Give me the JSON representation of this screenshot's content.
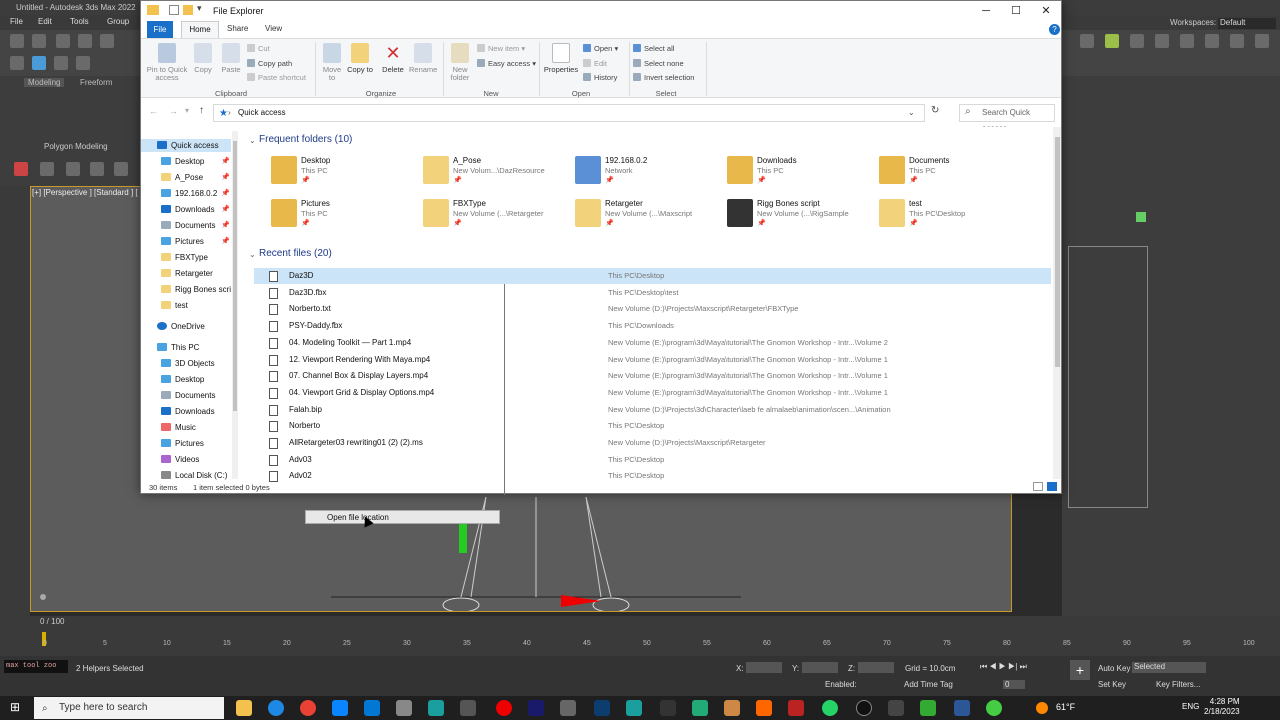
{
  "max": {
    "title": "Untitled - Autodesk 3ds Max 2022",
    "menu": [
      "File",
      "Edit",
      "Tools",
      "Group"
    ],
    "ribbon_tabs": [
      "Modeling",
      "Freeform"
    ],
    "ribbon_panel": "Polygon Modeling",
    "viewport_label": "[+] [Perspective ] [Standard ] [",
    "workspaces_label": "Workspaces:",
    "workspaces_value": "Default",
    "context_menu_item": "Open file location",
    "frame_counter": "0 / 100",
    "timeline_ticks": [
      "0",
      "5",
      "10",
      "15",
      "20",
      "25",
      "30",
      "35",
      "40",
      "45",
      "50",
      "55",
      "60",
      "65",
      "70",
      "75",
      "80",
      "85",
      "90",
      "95",
      "100"
    ],
    "maxscript_text": "max tool zoo",
    "selection_status": "2 Helpers Selected",
    "x_label": "X:",
    "y_label": "Y:",
    "z_label": "Z:",
    "grid_text": "Grid = 10.0cm",
    "enabled_label": "Enabled:",
    "add_time_tag": "Add Time Tag",
    "auto_key": "Auto Key",
    "set_key": "Set Key",
    "selected_dropdown": "Selected",
    "key_filters": "Key Filters...",
    "frame_field": "0"
  },
  "explorer": {
    "title": "File Explorer",
    "tabs": {
      "file": "File",
      "home": "Home",
      "share": "Share",
      "view": "View"
    },
    "ribbon": {
      "pin": "Pin to Quick access",
      "copy": "Copy",
      "paste": "Paste",
      "cut": "Cut",
      "copy_path": "Copy path",
      "paste_shortcut": "Paste shortcut",
      "group_clipboard": "Clipboard",
      "move_to": "Move to",
      "copy_to": "Copy to",
      "delete": "Delete",
      "rename": "Rename",
      "group_organize": "Organize",
      "new_folder": "New folder",
      "new_item": "New item",
      "easy_access": "Easy access",
      "group_new": "New",
      "properties": "Properties",
      "open": "Open",
      "edit": "Edit",
      "history": "History",
      "group_open": "Open",
      "select_all": "Select all",
      "select_none": "Select none",
      "invert_selection": "Invert selection",
      "group_select": "Select"
    },
    "address": "Quick access",
    "search_placeholder": "Search Quick access",
    "nav": {
      "quick_access": "Quick access",
      "pinned": [
        "Desktop",
        "A_Pose",
        "192.168.0.2",
        "Downloads",
        "Documents",
        "Pictures"
      ],
      "unpinned": [
        "FBXType",
        "Retargeter",
        "Rigg Bones scri",
        "test"
      ],
      "onedrive": "OneDrive",
      "this_pc": "This PC",
      "pc_items": [
        "3D Objects",
        "Desktop",
        "Documents",
        "Downloads",
        "Music",
        "Pictures",
        "Videos",
        "Local Disk (C:)"
      ]
    },
    "frequent_header": "Frequent folders (10)",
    "frequent": [
      {
        "name": "Desktop",
        "loc": "This PC",
        "color": "#e8b84a"
      },
      {
        "name": "A_Pose",
        "loc": "New Volum...\\DazResource",
        "color": "#f2d27a"
      },
      {
        "name": "192.168.0.2",
        "loc": "Network",
        "color": "#5b8fd6"
      },
      {
        "name": "Downloads",
        "loc": "This PC",
        "color": "#e8b84a"
      },
      {
        "name": "Documents",
        "loc": "This PC",
        "color": "#e8b84a"
      },
      {
        "name": "Pictures",
        "loc": "This PC",
        "color": "#e8b84a"
      },
      {
        "name": "FBXType",
        "loc": "New Volume (...\\Retargeter",
        "color": "#f2d27a"
      },
      {
        "name": "Retargeter",
        "loc": "New Volume (...\\Maxscript",
        "color": "#f2d27a"
      },
      {
        "name": "Rigg Bones script",
        "loc": "New Volume (...\\RigSample",
        "color": "#333333"
      },
      {
        "name": "test",
        "loc": "This PC\\Desktop",
        "color": "#f2d27a"
      }
    ],
    "pin_glyph": "📌",
    "recent_header": "Recent files (20)",
    "recent": [
      {
        "name": "Daz3D",
        "path": "This PC\\Desktop"
      },
      {
        "name": "Daz3D.fbx",
        "path": "This PC\\Desktop\\test"
      },
      {
        "name": "Norberto.txt",
        "path": "New Volume (D:)\\Projects\\Maxscript\\Retargeter\\FBXType"
      },
      {
        "name": "PSY-Daddy.fbx",
        "path": "This PC\\Downloads"
      },
      {
        "name": "04. Modeling Toolkit — Part 1.mp4",
        "path": "New Volume (E:)\\program\\3d\\Maya\\tutorial\\The Gnomon Workshop - Intr...\\Volume 2"
      },
      {
        "name": "12. Viewport Rendering With Maya.mp4",
        "path": "New Volume (E:)\\program\\3d\\Maya\\tutorial\\The Gnomon Workshop - Intr...\\Volume 1"
      },
      {
        "name": "07. Channel Box & Display Layers.mp4",
        "path": "New Volume (E:)\\program\\3d\\Maya\\tutorial\\The Gnomon Workshop - Intr...\\Volume 1"
      },
      {
        "name": "04. Viewport Grid & Display Options.mp4",
        "path": "New Volume (E:)\\program\\3d\\Maya\\tutorial\\The Gnomon Workshop - Intr...\\Volume 1"
      },
      {
        "name": "Falah.bip",
        "path": "New Volume (D:)\\Projects\\3d\\Character\\laeb fe almalaeb\\animation\\scen...\\Animation"
      },
      {
        "name": "Norberto",
        "path": "This PC\\Desktop"
      },
      {
        "name": "AllRetargeter03 rewriting01 (2) (2).ms",
        "path": "New Volume (D:)\\Projects\\Maxscript\\Retargeter"
      },
      {
        "name": "Adv03",
        "path": "This PC\\Desktop"
      },
      {
        "name": "Adv02",
        "path": "This PC\\Desktop"
      }
    ],
    "status_items": "30 items",
    "status_selected": "1 item selected  0 bytes"
  },
  "taskbar": {
    "search_placeholder": "Type here to search",
    "temperature": "61°F",
    "language": "ENG",
    "time": "4:28 PM",
    "date": "2/18/2023"
  }
}
